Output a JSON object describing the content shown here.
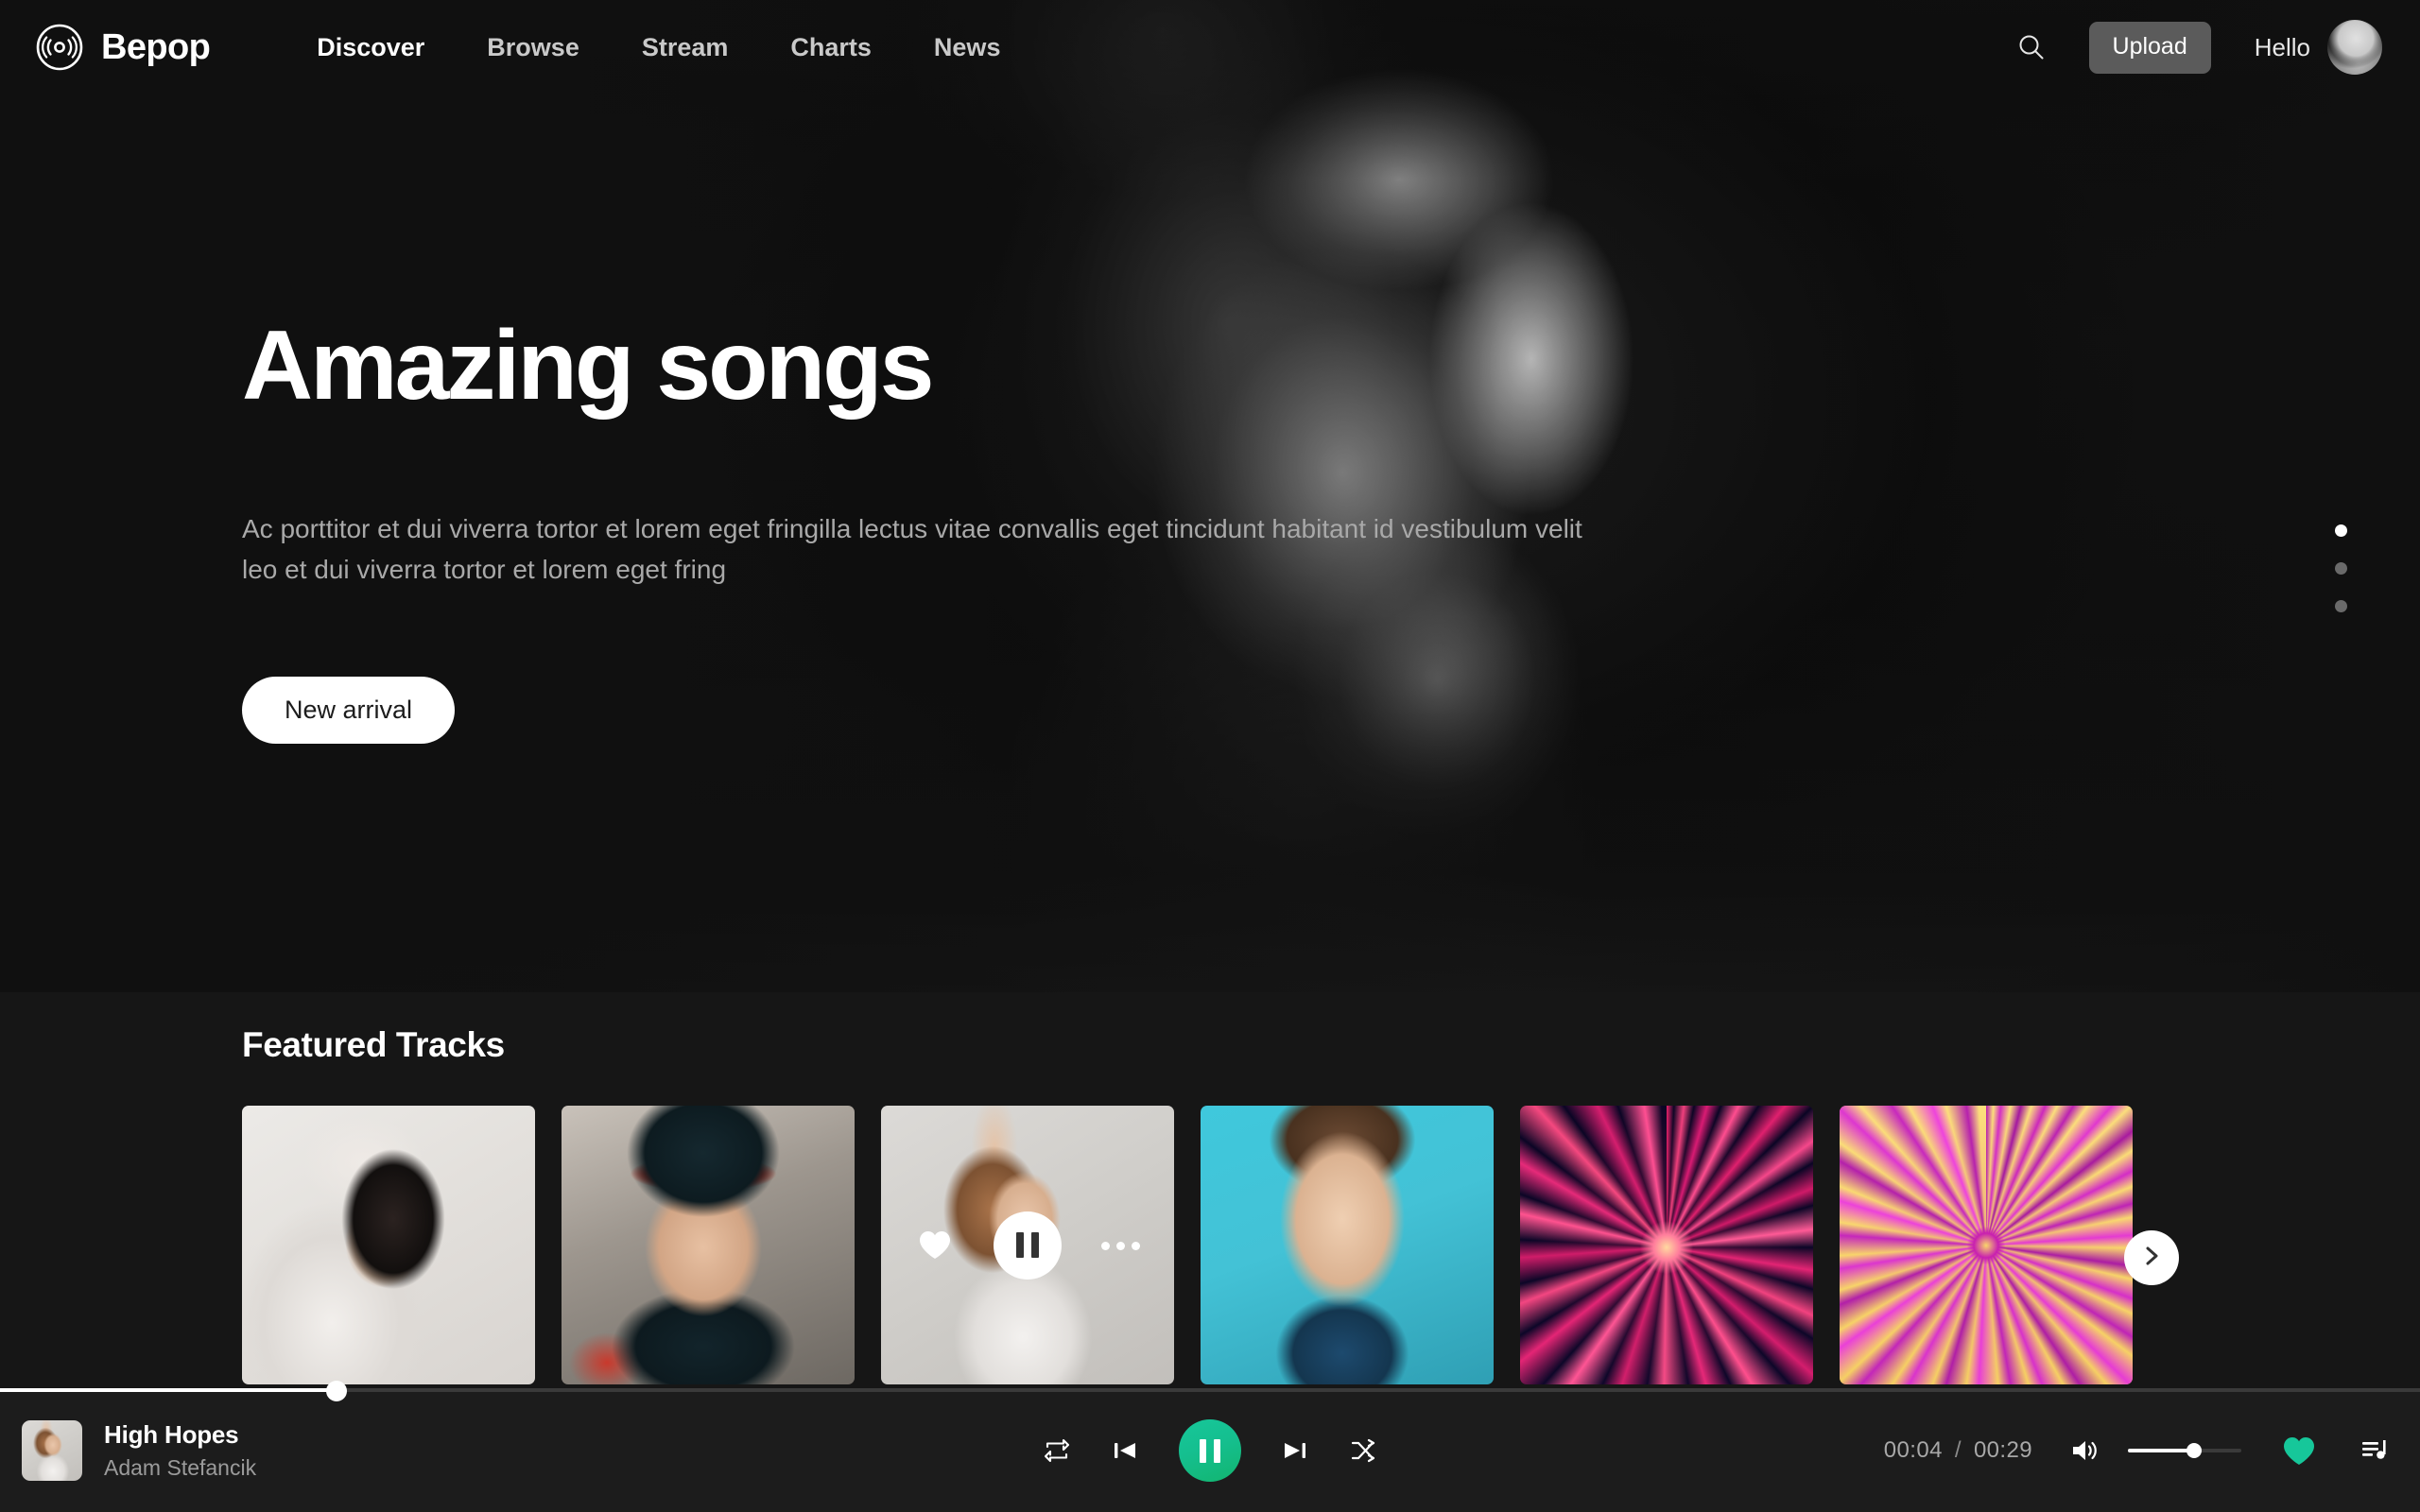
{
  "brand": {
    "name": "Bepop",
    "logo_icon": "vinyl-record-icon"
  },
  "nav": {
    "items": [
      {
        "label": "Discover",
        "active": true
      },
      {
        "label": "Browse",
        "active": false
      },
      {
        "label": "Stream",
        "active": false
      },
      {
        "label": "Charts",
        "active": false
      },
      {
        "label": "News",
        "active": false
      }
    ]
  },
  "header": {
    "search_icon": "search-icon",
    "upload_label": "Upload",
    "greeting": "Hello",
    "avatar_icon": "user-avatar"
  },
  "hero": {
    "title": "Amazing songs",
    "description": "Ac porttitor et dui viverra tortor et lorem eget fringilla lectus vitae convallis eget tincidunt habitant id vestibulum velit leo et dui viverra tortor et lorem eget fring",
    "cta_label": "New arrival",
    "slide_count": 3,
    "active_slide": 1
  },
  "featured": {
    "title": "Featured Tracks",
    "next_icon": "chevron-right-icon",
    "cards": [
      {
        "art": "art-1",
        "hovered": false
      },
      {
        "art": "art-2",
        "hovered": false
      },
      {
        "art": "art-3",
        "hovered": true
      },
      {
        "art": "art-4",
        "hovered": false
      },
      {
        "art": "art-5",
        "hovered": false
      },
      {
        "art": "art-6",
        "hovered": false
      }
    ],
    "overlay": {
      "like_icon": "heart-filled-icon",
      "play_icon": "pause-icon",
      "more_icon": "more-horizontal-icon"
    }
  },
  "player": {
    "track_title": "High Hopes",
    "track_artist": "Adam Stefancik",
    "progress_percent": 13.9,
    "current_time": "00:04",
    "time_separator": "/",
    "total_time": "00:29",
    "volume_percent": 58,
    "controls": {
      "repeat_icon": "repeat-icon",
      "previous_icon": "skip-previous-icon",
      "play_pause_icon": "pause-icon",
      "next_icon": "skip-next-icon",
      "shuffle_icon": "shuffle-icon",
      "volume_icon": "volume-icon",
      "like_icon": "heart-filled-icon",
      "queue_icon": "queue-music-icon"
    }
  },
  "colors": {
    "background": "#161616",
    "player_background": "#1c1c1c",
    "accent_green": "#16c79a",
    "accent_teal": "#12b58f",
    "text_primary": "#ffffff",
    "text_muted": "#a9a9a9",
    "upload_button": "#5b5b5b"
  }
}
